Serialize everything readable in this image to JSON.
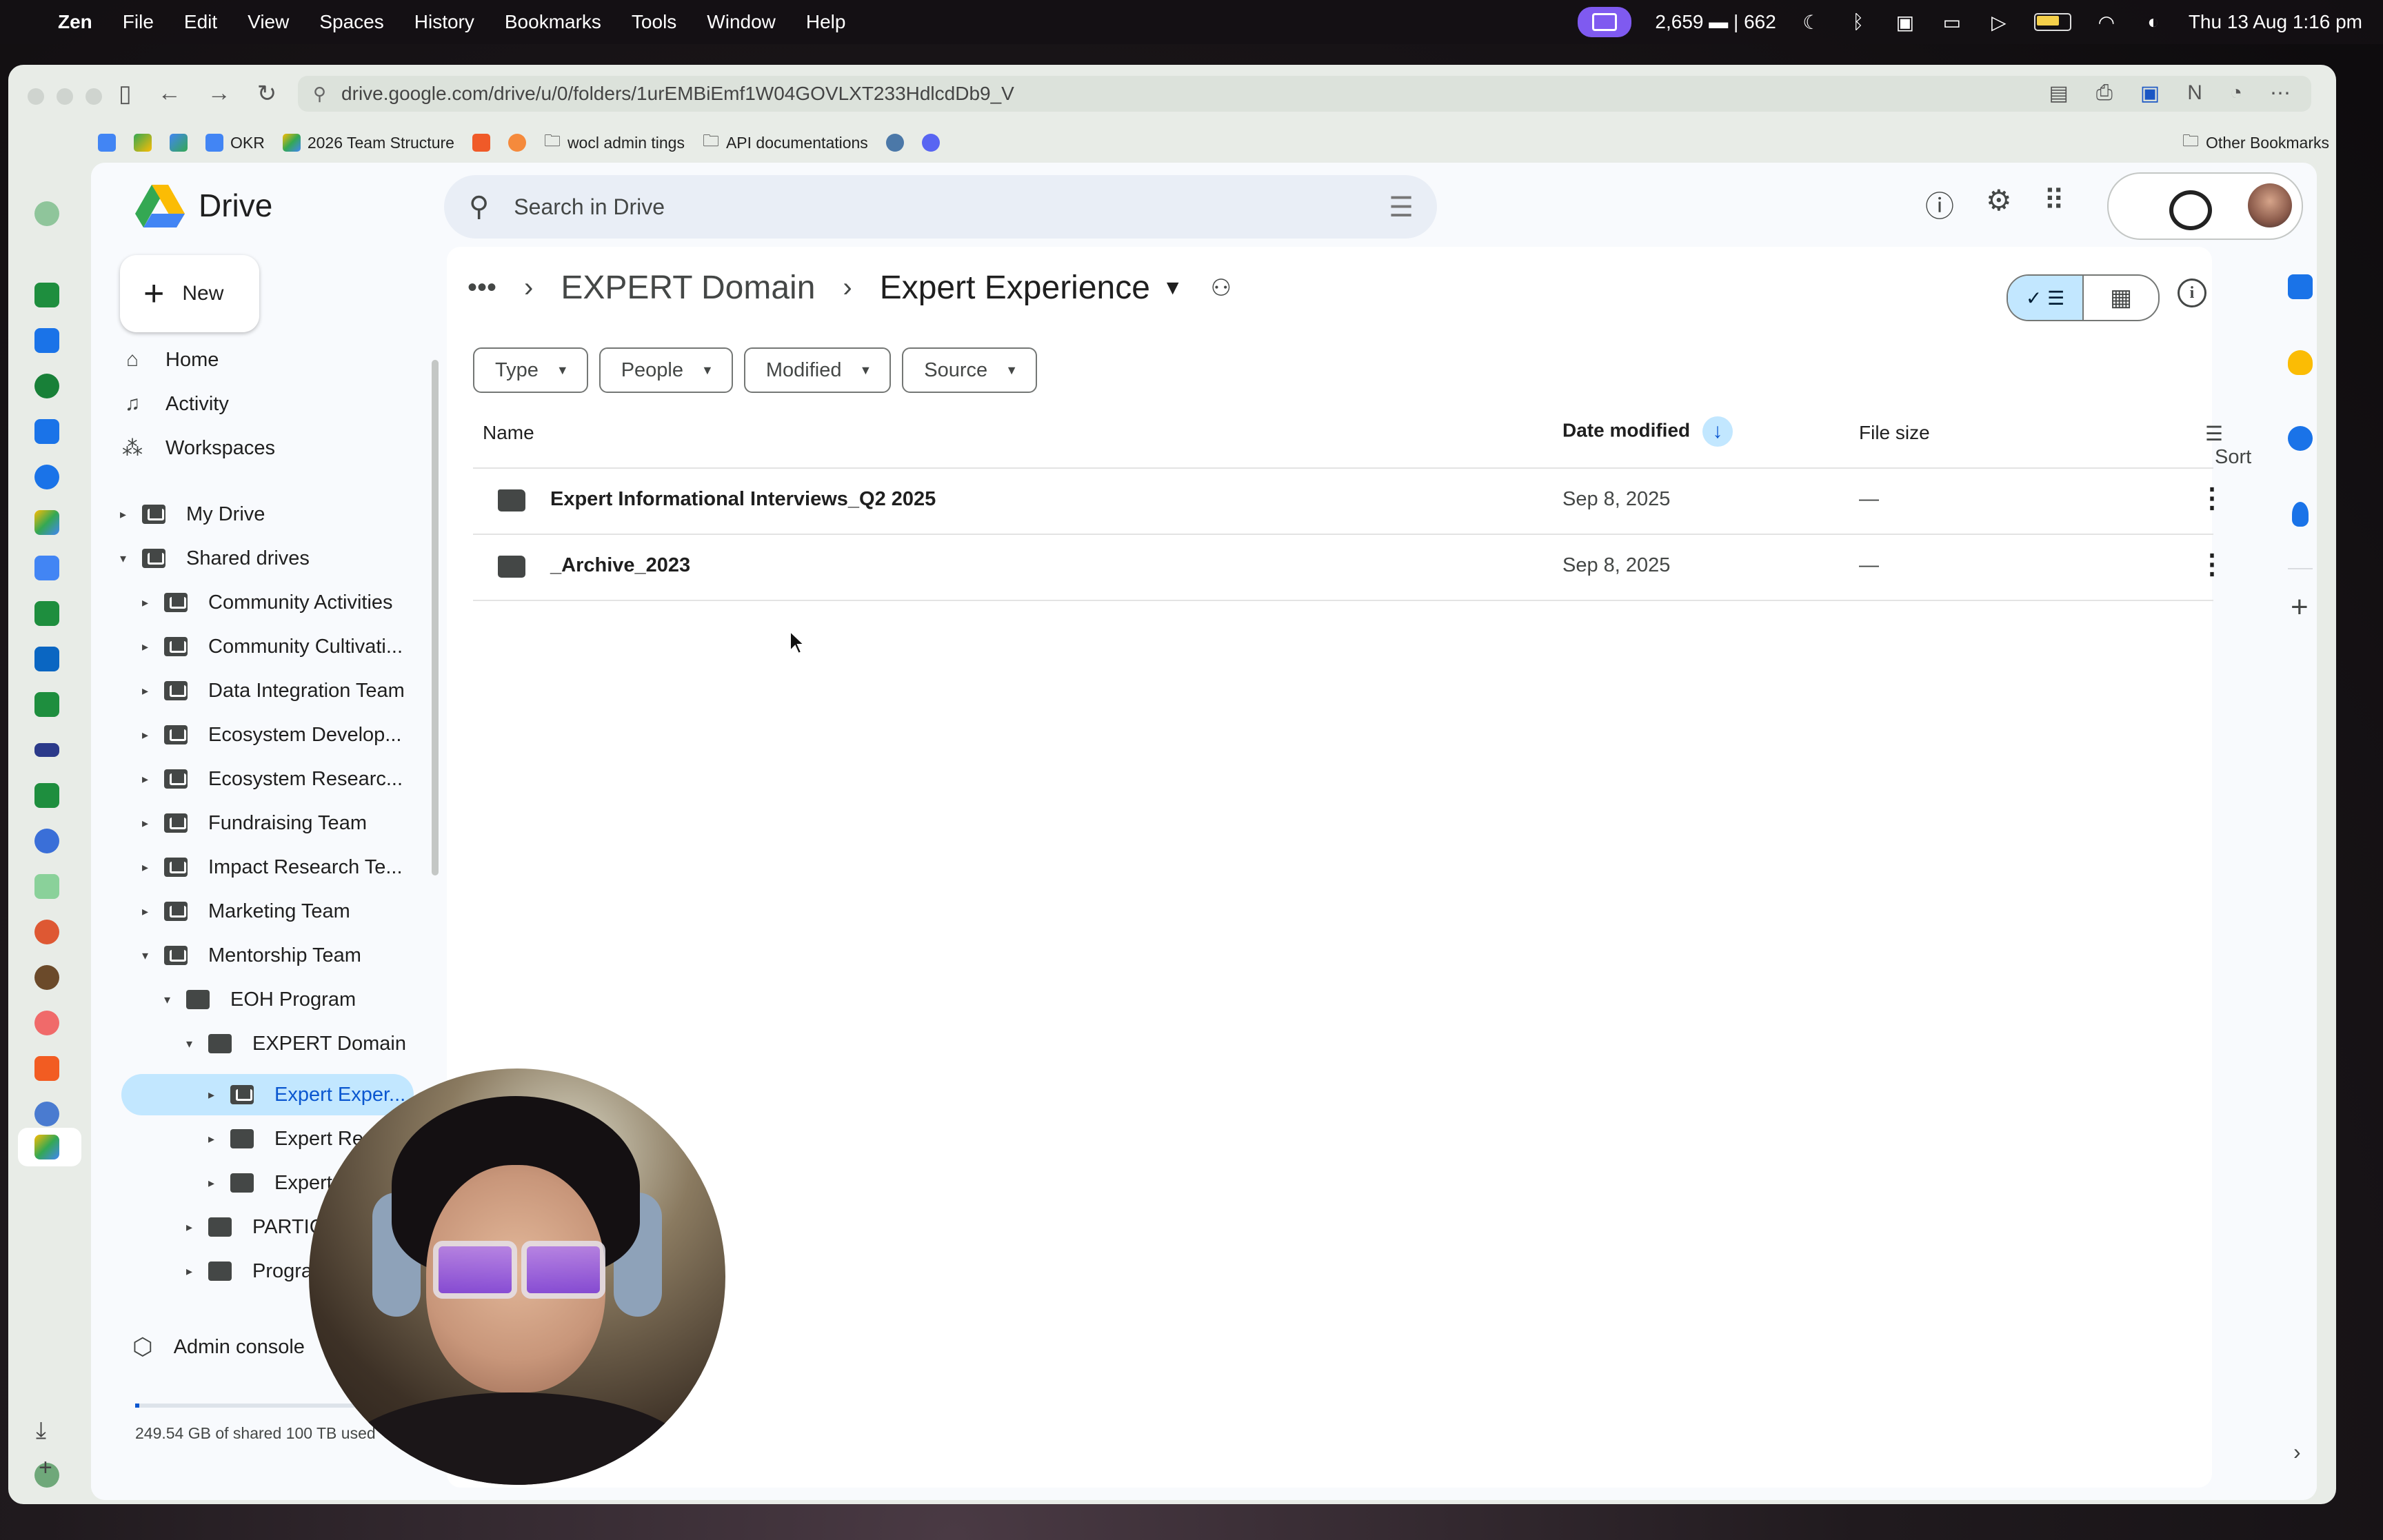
{
  "menubar": {
    "app_name": "Zen",
    "menus": [
      "File",
      "Edit",
      "View",
      "Spaces",
      "History",
      "Bookmarks",
      "Tools",
      "Window",
      "Help"
    ],
    "stats": "2,659 ▬ | 662",
    "datetime": "Thu 13 Aug  1:16 pm"
  },
  "browser": {
    "url": "drive.google.com/drive/u/0/folders/1urEMBiEmf1W04GOVLXT233HdlcdDb9_V",
    "bookmarks": [
      {
        "label": "OKR",
        "color": "#4285f4"
      },
      {
        "label": "2026 Team Structure",
        "color": "#fbbc04"
      },
      {
        "label": "wocl admin tings",
        "color": "folder"
      },
      {
        "label": "API documentations",
        "color": "folder"
      }
    ],
    "other_bookmarks": "Other Bookmarks"
  },
  "drive": {
    "app_title": "Drive",
    "search_placeholder": "Search in Drive",
    "new_label": "New",
    "nav": [
      {
        "label": "Home",
        "icon": "home-icon"
      },
      {
        "label": "Activity",
        "icon": "bell-icon"
      },
      {
        "label": "Workspaces",
        "icon": "workspaces-icon"
      }
    ],
    "my_drive": "My Drive",
    "shared_drives": "Shared drives",
    "shared_list": [
      "Community Activities",
      "Community Cultivati...",
      "Data Integration Team",
      "Ecosystem Develop...",
      "Ecosystem Researc...",
      "Fundraising Team",
      "Impact Research Te...",
      "Marketing Team",
      "Mentorship Team"
    ],
    "tree": {
      "eoh": "EOH Program",
      "expert_domain": "EXPERT Domain",
      "expert_exper": "Expert Exper...",
      "expert_re": "Expert Re",
      "expert3": "Expert",
      "partic": "PARTIC",
      "progra": "Progra"
    },
    "admin_console": "Admin console",
    "storage_text": "249.54 GB of shared 100 TB used",
    "breadcrumb": {
      "parent": "EXPERT Domain",
      "current": "Expert Experience"
    },
    "filters": [
      "Type",
      "People",
      "Modified",
      "Source"
    ],
    "columns": {
      "name": "Name",
      "date_modified": "Date modified",
      "file_size": "File size",
      "sort": "Sort"
    },
    "files": [
      {
        "name": "Expert Informational Interviews_Q2 2025",
        "date": "Sep 8, 2025",
        "size": "—"
      },
      {
        "name": "_Archive_2023",
        "date": "Sep 8, 2025",
        "size": "—"
      }
    ]
  },
  "colors": {
    "accent": "#0b57d0",
    "selected": "#c2e7ff"
  }
}
